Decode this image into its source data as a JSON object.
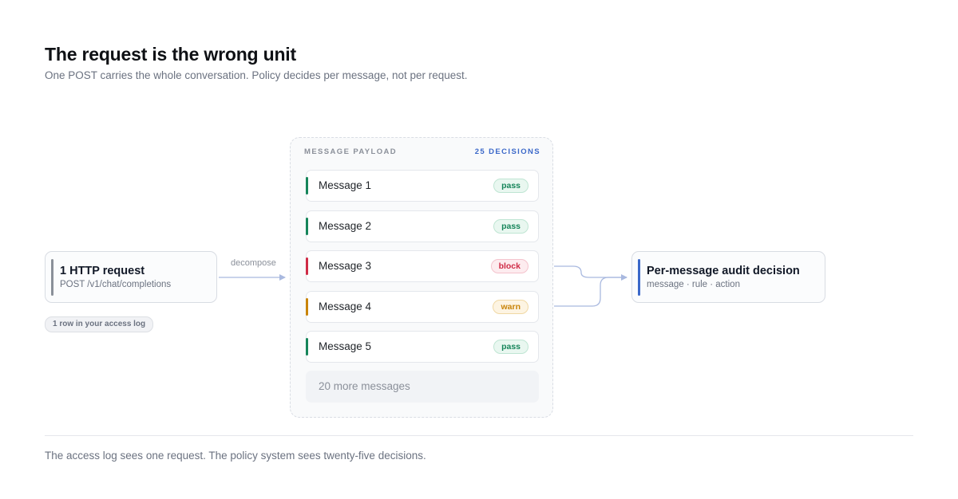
{
  "header": {
    "title": "The request is the wrong unit",
    "subtitle": "One POST carries the whole conversation. Policy decides per message, not per request."
  },
  "request": {
    "title": "1 HTTP request",
    "endpoint": "POST /v1/chat/completions",
    "log_pill": "1 row in your access log"
  },
  "connector": {
    "label": "decompose"
  },
  "payload": {
    "label": "MESSAGE PAYLOAD",
    "count": "25 DECISIONS",
    "messages": [
      {
        "name": "Message 1",
        "status": "pass"
      },
      {
        "name": "Message 2",
        "status": "pass"
      },
      {
        "name": "Message 3",
        "status": "block"
      },
      {
        "name": "Message 4",
        "status": "warn"
      },
      {
        "name": "Message 5",
        "status": "pass"
      }
    ],
    "more": "20 more messages"
  },
  "decision": {
    "title": "Per-message audit decision",
    "fields": "message · rule · action"
  },
  "footer": {
    "text": "The access log sees one request. The policy system sees twenty-five decisions."
  },
  "colors": {
    "pass": "#16855a",
    "block": "#cf2b46",
    "warn": "#c98409",
    "accent": "#3b68c9",
    "connector": "#a9b9df"
  }
}
